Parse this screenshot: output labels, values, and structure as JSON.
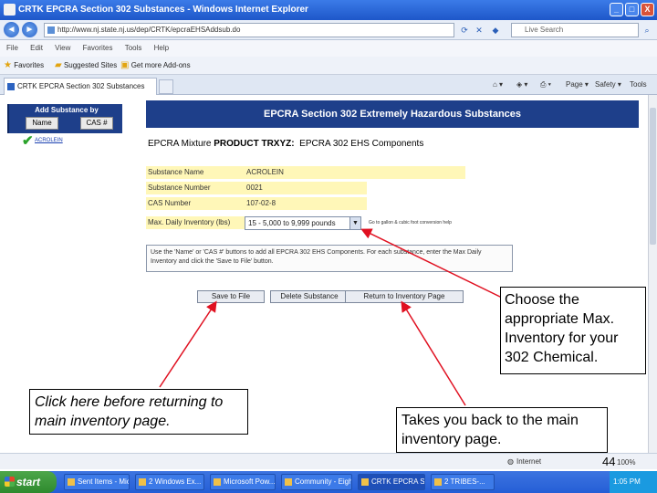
{
  "window": {
    "title": "CRTK EPCRA Section 302 Substances - Windows Internet Explorer",
    "minimize": "_",
    "maximize": "□",
    "close": "X"
  },
  "address": {
    "back": "◄",
    "forward": "►",
    "url": "http://www.nj.state.nj.us/dep/CRTK/epcraEHSAddsub.do",
    "search_placeholder": "Live Search"
  },
  "menu": [
    "File",
    "Edit",
    "View",
    "Favorites",
    "Tools",
    "Help"
  ],
  "favorites_bar": {
    "favorites": "Favorites",
    "suggested": "Suggested Sites",
    "addons": "Get more Add-ons"
  },
  "tab": {
    "title": "CRTK EPCRA Section 302 Substances",
    "commands": [
      "Page",
      "Safety",
      "Tools"
    ]
  },
  "sidebar": {
    "title": "Add Substance by",
    "buttons": [
      "Name",
      "CAS #"
    ],
    "link": "ACROLEIN"
  },
  "main": {
    "banner": "EPCRA Section 302 Extremely Hazardous Substances",
    "mixture_prefix": "EPCRA Mixture",
    "mixture_product": "PRODUCT TRXYZ:",
    "mixture_suffix": "EPCRA 302 EHS Components",
    "fields": [
      {
        "label": "Substance Name",
        "value": "ACROLEIN"
      },
      {
        "label": "Substance Number",
        "value": "0021"
      },
      {
        "label": "CAS Number",
        "value": "107-02-8"
      }
    ],
    "inventory_label": "Max. Daily Inventory (lbs)",
    "inventory_value": "15 - 5,000 to 9,999 pounds",
    "conversion_link": "Go to gallon & cubic foot conversion help",
    "instructions": "Use the 'Name' or 'CAS #' buttons to add all EPCRA 302 EHS Components. For each substance, enter the Max Daily Inventory and click the 'Save to File' button.",
    "buttons": [
      "Save to File",
      "Delete Substance",
      "Return to Inventory Page"
    ]
  },
  "callouts": {
    "inventory": "Choose the appropriate Max. Inventory for your 302 Chemical.",
    "save": "Click here before returning to main inventory page.",
    "return": "Takes you back to the main inventory page."
  },
  "statusbar": {
    "zone": "Internet",
    "page_number": "44",
    "zoom": "100%"
  },
  "taskbar": {
    "start": "start",
    "items": [
      "Sent Items - Micr...",
      "2 Windows Ex...",
      "Microsoft Pow...",
      "Community - Eight...",
      "CRTK EPCRA Sect...",
      "2 TRIBES-..."
    ],
    "clock": "1:05 PM"
  },
  "colors": {
    "banner": "#1e3f8a",
    "field_bg": "#fff7b8",
    "arrow": "#e01020"
  }
}
